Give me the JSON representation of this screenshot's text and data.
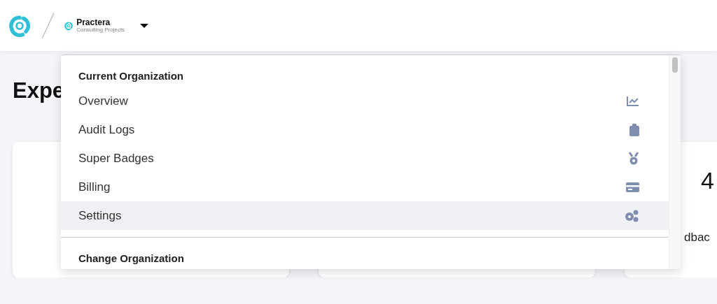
{
  "header": {
    "org_name": "Practera",
    "org_subtitle": "Consulting Projects"
  },
  "page": {
    "title": "Expe",
    "cards": [
      {
        "kind": "blank"
      },
      {
        "kind": "blank"
      },
      {
        "kind": "stat",
        "value": "4",
        "label": "dbac"
      }
    ]
  },
  "org_menu": {
    "sections": [
      {
        "heading": "Current Organization",
        "items": [
          {
            "label": "Overview",
            "selected": false
          },
          {
            "label": "Audit Logs",
            "selected": false
          },
          {
            "label": "Super Badges",
            "selected": false
          },
          {
            "label": "Billing",
            "selected": false
          },
          {
            "label": "Settings",
            "selected": true
          }
        ]
      },
      {
        "heading": "Change Organization"
      }
    ]
  }
}
